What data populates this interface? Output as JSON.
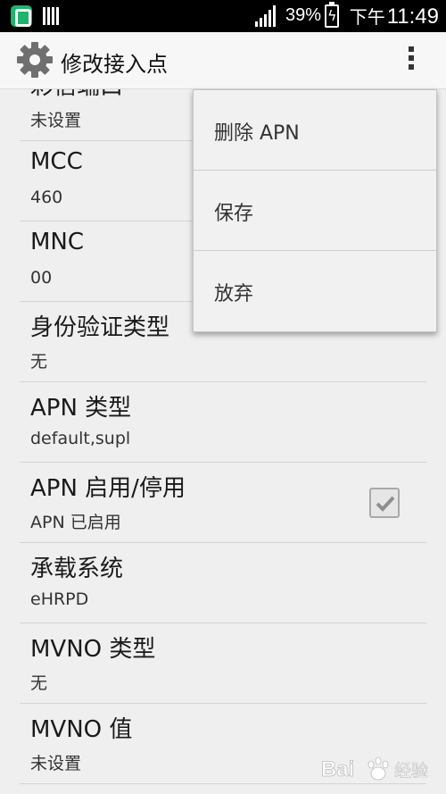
{
  "status_bar": {
    "battery_percent": "39%",
    "time_prefix": "下午",
    "time": "11:49",
    "icons": [
      "app-notification-icon",
      "barcode-icon",
      "signal-icon",
      "battery-charging-icon"
    ]
  },
  "action_bar": {
    "title": "修改接入点",
    "icon": "gear-icon",
    "overflow_icon": "overflow-menu-icon"
  },
  "settings": [
    {
      "title": "彩信端口",
      "summary": "未设置"
    },
    {
      "title": "MCC",
      "summary": "460"
    },
    {
      "title": "MNC",
      "summary": "00"
    },
    {
      "title": "身份验证类型",
      "summary": "无"
    },
    {
      "title": "APN 类型",
      "summary": "default,supl"
    },
    {
      "title": "APN 启用/停用",
      "summary": "APN 已启用",
      "checked": true
    },
    {
      "title": "承载系统",
      "summary": "eHRPD"
    },
    {
      "title": "MVNO 类型",
      "summary": "无"
    },
    {
      "title": "MVNO 值",
      "summary": "未设置"
    }
  ],
  "popup_menu": {
    "items": [
      "删除 APN",
      "保存",
      "放弃"
    ]
  },
  "watermark": {
    "text": "Bai 经验"
  },
  "colors": {
    "status_bar": "#000000",
    "background": "#efefef",
    "app_icon": "#1fb36b"
  }
}
